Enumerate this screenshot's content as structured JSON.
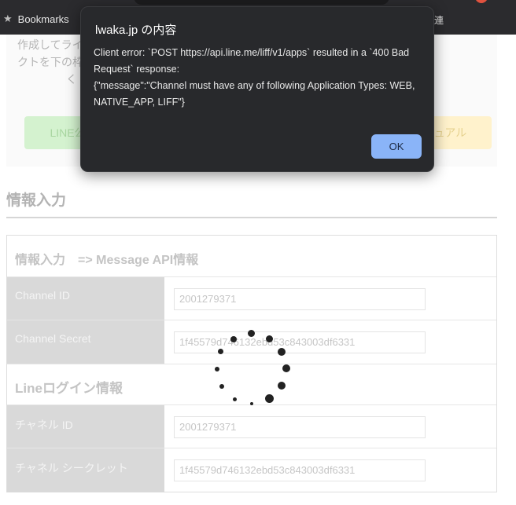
{
  "browser": {
    "bookmarks_label": "Bookmarks",
    "bookmarks_right_text": "連"
  },
  "page": {
    "intro_line1": "作成してライ",
    "intro_line2": "クトを下の枠",
    "intro_line3": "く",
    "line_official_button": "LINE公",
    "manual_button": "ュアル",
    "section_title": "情報入力",
    "table_heading": "情報入力　=> Message API情報",
    "rows": [
      {
        "label": "Channel ID",
        "value": "2001279371"
      },
      {
        "label": "Channel Secret",
        "value": "1f45579d746132ebd53c843003df6331"
      }
    ],
    "login_heading": "Lineログイン情報",
    "login_rows": [
      {
        "label": "チャネル ID",
        "value": "2001279371"
      },
      {
        "label": "チャネル シークレット",
        "value": "1f45579d746132ebd53c843003df6331"
      }
    ]
  },
  "alert": {
    "title": "lwaka.jp の内容",
    "message": "Client error: `POST https://api.line.me/liff/v1/apps` resulted in a `400 Bad Request` response:\n{\"message\":\"Channel must have any of following Application Types: WEB, NATIVE_APP, LIFF\"}",
    "ok_label": "OK",
    "ok_color": "#8ab4f8"
  }
}
